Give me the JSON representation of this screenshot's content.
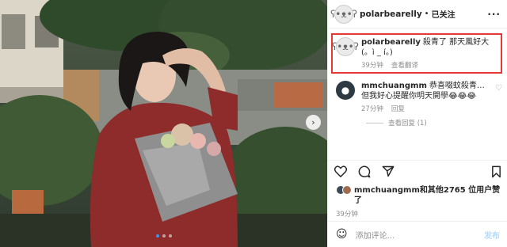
{
  "header": {
    "username": "polarbearelly",
    "separator": "•",
    "follow_status": "已关注",
    "more": "···"
  },
  "photo": {
    "next_icon": "chevron-right-icon",
    "dots_count": 3,
    "active_dot": 1
  },
  "caption": {
    "username": "polarbearelly",
    "text": "殺青了 那天風好大(。ì _ í。)",
    "time": "39分钟",
    "translate": "查看翻译"
  },
  "comments": [
    {
      "username": "mmchuangmm",
      "text": "恭喜啜蚊殺青… 但我好心提醒你明天開學😂😂😂",
      "time": "27分钟",
      "reply": "回复",
      "view_replies": "查看回复 (1)"
    }
  ],
  "actions": {
    "icons": [
      "heart-icon",
      "comment-icon",
      "share-icon",
      "bookmark-icon"
    ]
  },
  "likes": {
    "text": "mmchuangmm和其他2765 位用户赞了"
  },
  "post_time": "39分钟",
  "add_comment": {
    "emoji": "☺",
    "placeholder": "添加评论...",
    "post_label": "发布"
  },
  "colors": {
    "highlight_border": "#e53935",
    "active_dot": "#3897f0",
    "post_button": "#b3dbff"
  }
}
